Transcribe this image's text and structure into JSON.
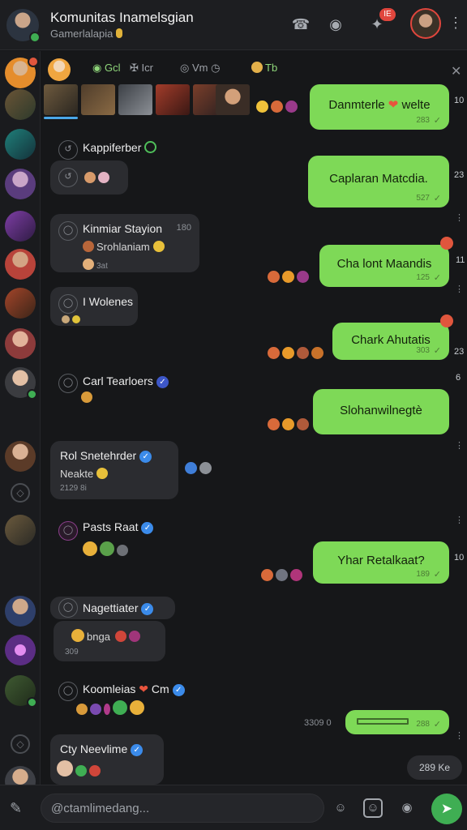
{
  "header": {
    "title": "Komunitas Inamelsgian",
    "subtitle": "Gamerlalapia",
    "badge": "IE",
    "icons": [
      "phone-icon",
      "group-icon",
      "notification-icon",
      "menu-icon"
    ]
  },
  "filters": [
    {
      "label": "Gcl",
      "icon": "game-icon"
    },
    {
      "label": "Icr",
      "icon": "sword-icon"
    },
    {
      "label": "Vm",
      "icon": "compass-icon"
    },
    {
      "label": "Tb",
      "icon": "avatar"
    }
  ],
  "incoming": [
    {
      "name": "Kappiferber",
      "sub": "",
      "time": "",
      "side_time": ""
    },
    {
      "name": "Kinmiar Stayion",
      "sub": "Srohlaniam",
      "time": "3at",
      "side_time": "180"
    },
    {
      "name": "I Wolenes",
      "sub": "",
      "time": "",
      "side_time": ""
    },
    {
      "name": "Carl Tearloers",
      "sub": "",
      "time": "",
      "side_time": ""
    },
    {
      "name": "Rol Snetehrder",
      "sub": "Neakte",
      "time": "2129 8i",
      "side_time": ""
    },
    {
      "name": "Pasts Raat",
      "sub": "",
      "time": "",
      "side_time": ""
    },
    {
      "name": "Nagettiater",
      "sub": "bnga",
      "time": "309",
      "side_time": ""
    },
    {
      "name": "Koomleias",
      "name_suffix": "Cm",
      "sub": "",
      "time": "",
      "side_time": ""
    },
    {
      "name": "Cty Neevlime",
      "sub": "",
      "time": "",
      "side_time": ""
    }
  ],
  "outgoing": [
    {
      "text": "Danmterle",
      "text_suffix": "welte",
      "time": "283",
      "side_time": "10"
    },
    {
      "text": "Caplaran Matcdia.",
      "time": "527",
      "side_time": "23"
    },
    {
      "text": "Cha lont Maandis",
      "time": "125",
      "side_time": "11"
    },
    {
      "text": "Chark Ahutatis",
      "time": "303",
      "side_time": "23"
    },
    {
      "text": "Slohanwilnegtè",
      "time": "",
      "side_time": "6"
    },
    {
      "text": "Yhar Retalkaat?",
      "time": "189",
      "side_time": "10"
    },
    {
      "text": "",
      "time": "288",
      "side_time": "",
      "left_time": "3309 0"
    }
  ],
  "last_stamp": "289 Ke",
  "composer": {
    "placeholder": "@ctamlimedang..."
  }
}
